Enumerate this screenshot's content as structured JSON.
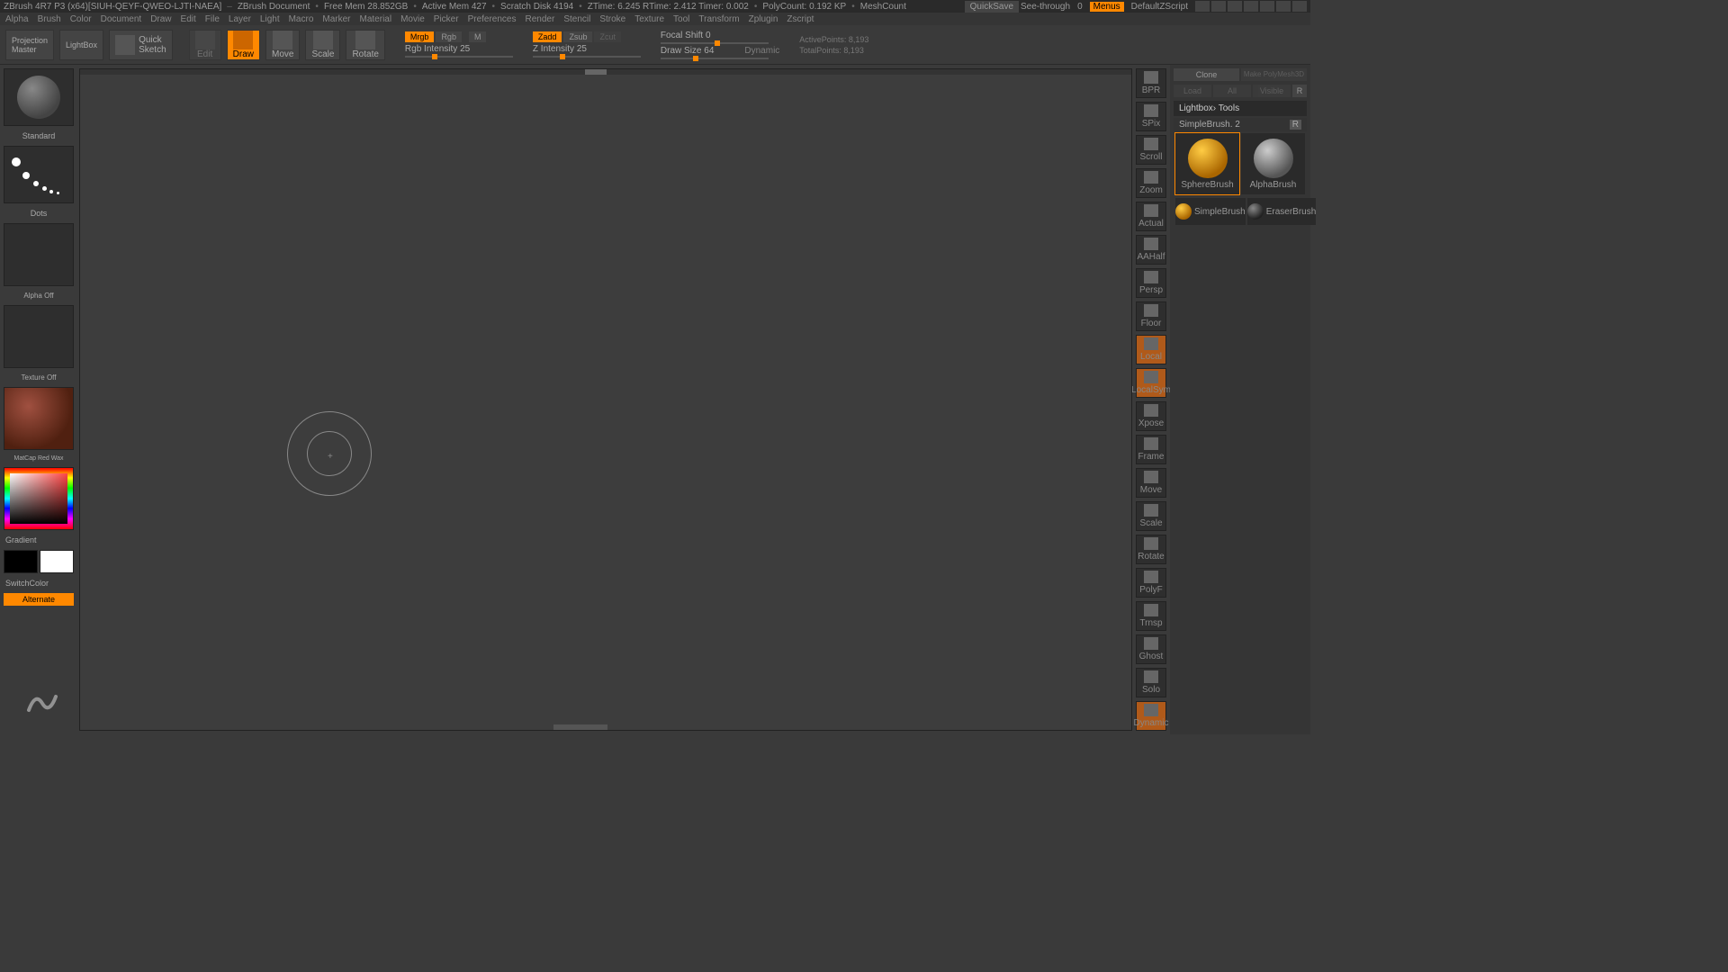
{
  "title": {
    "app": "ZBrush 4R7 P3 (x64)[SIUH-QEYF-QWEO-LJTI-NAEA]",
    "doc": "ZBrush Document",
    "freemem": "Free Mem 28.852GB",
    "activemem": "Active Mem 427",
    "scratch": "Scratch Disk 4194",
    "ztime": "ZTime: 6.245 RTime: 2.412 Timer: 0.002",
    "poly": "PolyCount: 0.192 KP",
    "mesh": "MeshCount",
    "quicksave": "QuickSave",
    "seethrough": "See-through",
    "seethrough_val": "0",
    "menus": "Menus",
    "script": "DefaultZScript"
  },
  "menus": [
    "Alpha",
    "Brush",
    "Color",
    "Document",
    "Draw",
    "Edit",
    "File",
    "Layer",
    "Light",
    "Macro",
    "Marker",
    "Material",
    "Movie",
    "Picker",
    "Preferences",
    "Render",
    "Stencil",
    "Stroke",
    "Texture",
    "Tool",
    "Transform",
    "Zplugin",
    "Zscript"
  ],
  "toolbar": {
    "projection": "Projection\nMaster",
    "lightbox": "LightBox",
    "quicksketch": "Quick\nSketch",
    "edit": "Edit",
    "draw": "Draw",
    "move": "Move",
    "scale": "Scale",
    "rotate": "Rotate",
    "mrgb": "Mrgb",
    "rgb": "Rgb",
    "m": "M",
    "rgb_int": "Rgb Intensity 25",
    "zadd": "Zadd",
    "zsub": "Zsub",
    "zcut": "Zcut",
    "z_int": "Z Intensity 25",
    "focal": "Focal Shift 0",
    "drawsize": "Draw Size 64",
    "dynamic": "Dynamic",
    "activepts": "ActivePoints: 8,193",
    "totalpts": "TotalPoints: 8,193"
  },
  "left": {
    "brush": "Standard",
    "stroke": "Dots",
    "alpha": "Alpha Off",
    "texture": "Texture Off",
    "material": "MatCap Red Wax",
    "gradient": "Gradient",
    "switch": "SwitchColor",
    "alternate": "Alternate"
  },
  "rightnav": [
    "BPR",
    "SPix",
    "Scroll",
    "Zoom",
    "Actual",
    "AAHalf",
    "Persp",
    "Floor",
    "Local",
    "LocalSym",
    "Xpose",
    "Frame",
    "Move",
    "Scale",
    "Rotate",
    "PolyF",
    "Trnsp",
    "Ghost",
    "Solo",
    "Dynamic"
  ],
  "rp": {
    "clone": "Clone",
    "make": "Make PolyMesh3D",
    "all": "All",
    "visible": "Visible",
    "r": "R",
    "lightbox": "Lightbox› Tools",
    "simple": "SimpleBrush. 2",
    "tools": [
      {
        "name": "SphereBrush"
      },
      {
        "name": "AlphaBrush"
      },
      {
        "name": "SimpleBrush"
      },
      {
        "name": "EraserBrush"
      }
    ]
  }
}
